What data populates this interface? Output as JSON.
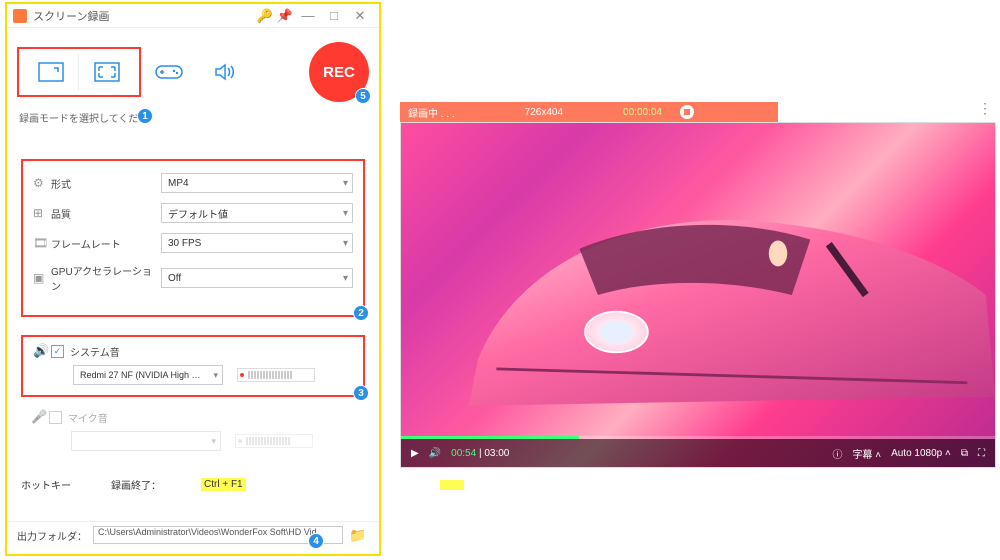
{
  "app": {
    "title": "スクリーン録画",
    "rec_label": "REC",
    "mode_hint": "録画モードを選択してくださ"
  },
  "settings": {
    "format": {
      "label": "形式",
      "value": "MP4"
    },
    "quality": {
      "label": "品質",
      "value": "デフォルト値"
    },
    "framerate": {
      "label": "フレームレート",
      "value": "30 FPS"
    },
    "gpu": {
      "label": "GPUアクセラレーション",
      "value": "Off"
    }
  },
  "audio": {
    "system_label": "システム音",
    "device": "Redmi 27 NF (NVIDIA High …",
    "mic_label": "マイク音"
  },
  "hotkey": {
    "label": "ホットキー",
    "stop_label": "録画終了：",
    "stop_key": "Ctrl + F1"
  },
  "output": {
    "label": "出力フォルダ：",
    "path": "C:\\Users\\Administrator\\Videos\\WonderFox Soft\\HD Vid"
  },
  "badges": {
    "b1": "1",
    "b2": "2",
    "b3": "3",
    "b4": "4",
    "b5": "5"
  },
  "recbar": {
    "status": "録画中 . . .",
    "resolution": "726x404",
    "elapsed": "00:00:04"
  },
  "player": {
    "current": "00:54",
    "duration": "03:00",
    "subtitle_btn": "字幕",
    "quality_btn": "Auto 1080p"
  }
}
